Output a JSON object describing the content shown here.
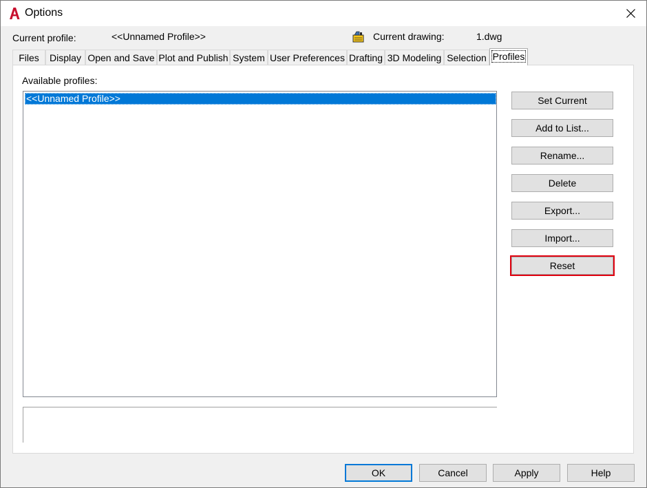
{
  "window": {
    "title": "Options"
  },
  "profile_bar": {
    "current_profile_label": "Current profile:",
    "current_profile_value": "<<Unnamed Profile>>",
    "current_drawing_label": "Current drawing:",
    "current_drawing_value": "1.dwg",
    "drawing_icon": "drawing-file-icon"
  },
  "tabs": [
    {
      "label": "Files"
    },
    {
      "label": "Display"
    },
    {
      "label": "Open and Save"
    },
    {
      "label": "Plot and Publish"
    },
    {
      "label": "System"
    },
    {
      "label": "User Preferences"
    },
    {
      "label": "Drafting"
    },
    {
      "label": "3D Modeling"
    },
    {
      "label": "Selection"
    },
    {
      "label": "Profiles",
      "active": true
    }
  ],
  "profiles_panel": {
    "available_label": "Available profiles:",
    "profiles": [
      "<<Unnamed Profile>>"
    ],
    "selected_profile": "<<Unnamed Profile>>",
    "description": ""
  },
  "side_buttons": [
    {
      "label": "Set Current"
    },
    {
      "label": "Add to List..."
    },
    {
      "label": "Rename..."
    },
    {
      "label": "Delete"
    },
    {
      "label": "Export..."
    },
    {
      "label": "Import..."
    },
    {
      "label": "Reset",
      "highlighted": true
    }
  ],
  "footer_buttons": [
    {
      "label": "OK",
      "default": true
    },
    {
      "label": "Cancel"
    },
    {
      "label": "Apply"
    },
    {
      "label": "Help"
    }
  ],
  "colors": {
    "selection": "#0078d7",
    "highlight_border": "#e0000e",
    "app_icon": "#c8102e"
  }
}
